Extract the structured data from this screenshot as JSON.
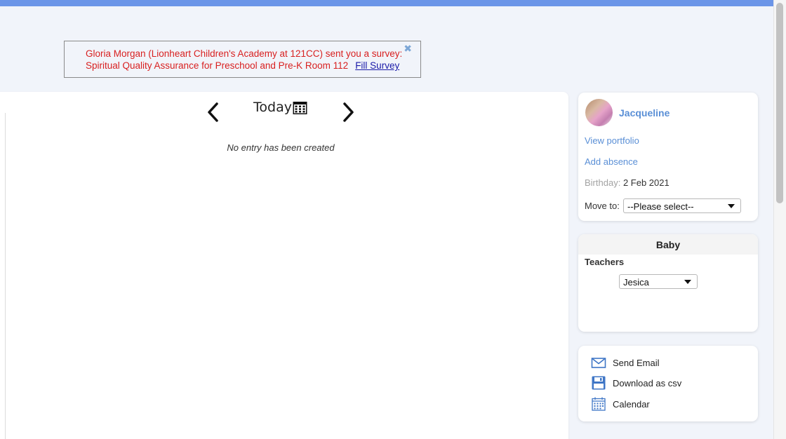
{
  "notice": {
    "line1": "Gloria Morgan (Lionheart Children's Academy at 121CC) sent you a survey:",
    "line2": "Spiritual Quality Assurance for Preschool and Pre-K Room 112",
    "link": "Fill Survey",
    "close_glyph": "✖"
  },
  "journal": {
    "date_label": "Today",
    "empty_message": "No entry has been created"
  },
  "child": {
    "name": "Jacqueline",
    "view_portfolio": "View portfolio",
    "add_absence": "Add absence",
    "birthday_label": "Birthday:",
    "birthday_value": "2 Feb 2021",
    "move_label": "Move to:",
    "move_value": "--Please select--"
  },
  "room": {
    "name": "Baby",
    "teachers_label": "Teachers",
    "teacher_value": "Jesica"
  },
  "actions": [
    {
      "label": "Send Email",
      "icon": "envelope-icon"
    },
    {
      "label": "Download as csv",
      "icon": "floppy-disk-icon"
    },
    {
      "label": "Calendar",
      "icon": "calendar-icon"
    }
  ],
  "colors": {
    "top_bar": "#6b95e8",
    "link": "#5a8fd6",
    "notice_text": "#d81f1f",
    "background": "#f1f4fa"
  }
}
